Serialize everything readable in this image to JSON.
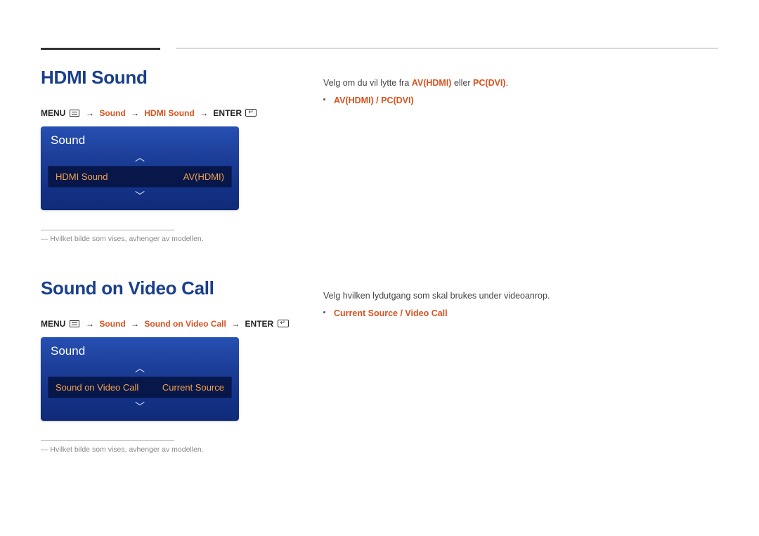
{
  "section1": {
    "title": "HDMI Sound",
    "breadcrumb": {
      "menu_label": "MENU",
      "path1": "Sound",
      "path2": "HDMI Sound",
      "enter_label": "ENTER"
    },
    "panel": {
      "title": "Sound",
      "item_label": "HDMI Sound",
      "item_value": "AV(HDMI)"
    },
    "footnote": "― Hvilket bilde som vises, avhenger av modellen.",
    "desc_prefix": "Velg om du vil lytte fra ",
    "desc_hl1": "AV(HDMI)",
    "desc_mid": " eller ",
    "desc_hl2": "PC(DVI)",
    "desc_suffix": ".",
    "bullet": "AV(HDMI) / PC(DVI)"
  },
  "section2": {
    "title": "Sound on Video Call",
    "breadcrumb": {
      "menu_label": "MENU",
      "path1": "Sound",
      "path2": "Sound on Video Call",
      "enter_label": "ENTER"
    },
    "panel": {
      "title": "Sound",
      "item_label": "Sound on Video Call",
      "item_value": "Current Source"
    },
    "footnote": "― Hvilket bilde som vises, avhenger av modellen.",
    "desc": "Velg hvilken lydutgang som skal brukes under videoanrop.",
    "bullet": "Current Source / Video Call"
  }
}
